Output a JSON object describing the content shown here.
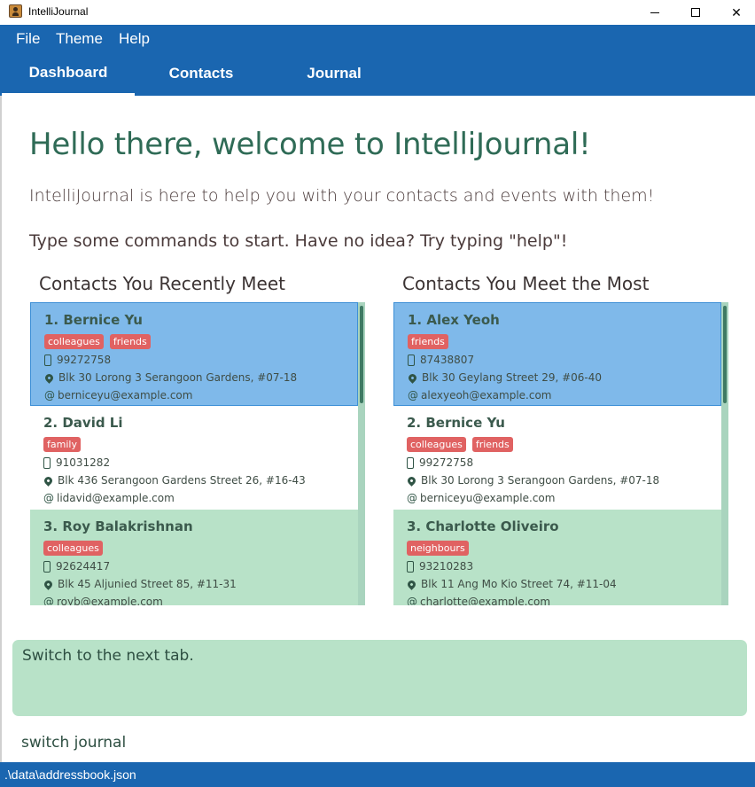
{
  "window": {
    "title": "IntelliJournal",
    "icon": "app-icon",
    "minimize_icon": "minimize-icon",
    "maximize_icon": "maximize-icon",
    "close_icon": "close-icon",
    "close_glyph": "✕"
  },
  "menu": {
    "items": [
      "File",
      "Theme",
      "Help"
    ]
  },
  "tabs": [
    {
      "label": "Dashboard",
      "active": true
    },
    {
      "label": "Contacts",
      "active": false
    },
    {
      "label": "Journal",
      "active": false
    }
  ],
  "dashboard": {
    "welcome": "Hello there, welcome to IntelliJournal!",
    "intro_line_1": "IntelliJournal is here to help you with your contacts and events with them!",
    "intro_line_2": "Type some commands to start. Have no idea? Try typing \"help\"!",
    "recent_title": "Contacts You Recently Meet",
    "most_title": "Contacts You Meet the Most",
    "recent": [
      {
        "name": "1.  Bernice Yu",
        "tags": [
          "colleagues",
          "friends"
        ],
        "phone": "99272758",
        "address": "Blk 30 Lorong 3 Serangoon Gardens, #07-18",
        "email": "berniceyu@example.com",
        "style": "sel"
      },
      {
        "name": "2.  David Li",
        "tags": [
          "family"
        ],
        "phone": "91031282",
        "address": "Blk 436 Serangoon Gardens Street 26, #16-43",
        "email": "lidavid@example.com",
        "style": "plain"
      },
      {
        "name": "3.  Roy Balakrishnan",
        "tags": [
          "colleagues"
        ],
        "phone": "92624417",
        "address": "Blk 45 Aljunied Street 85, #11-31",
        "email": "royb@example.com",
        "style": "alt"
      }
    ],
    "most": [
      {
        "name": "1.  Alex Yeoh",
        "tags": [
          "friends"
        ],
        "phone": "87438807",
        "address": "Blk 30 Geylang Street 29, #06-40",
        "email": "alexyeoh@example.com",
        "style": "sel"
      },
      {
        "name": "2.  Bernice Yu",
        "tags": [
          "colleagues",
          "friends"
        ],
        "phone": "99272758",
        "address": "Blk 30 Lorong 3 Serangoon Gardens, #07-18",
        "email": "berniceyu@example.com",
        "style": "plain"
      },
      {
        "name": "3.  Charlotte Oliveiro",
        "tags": [
          "neighbours"
        ],
        "phone": "93210283",
        "address": "Blk 11 Ang Mo Kio Street 74, #11-04",
        "email": "charlotte@example.com",
        "style": "alt"
      }
    ],
    "icons": {
      "phone": "phone-icon",
      "address": "location-pin-icon",
      "email": "at-sign-icon",
      "email_glyph": "@"
    }
  },
  "result": {
    "text": "Switch to the next tab."
  },
  "command": {
    "value": "switch journal"
  },
  "status": {
    "path": ".\\data\\addressbook.json"
  },
  "colors": {
    "accent": "#1a66b0",
    "selected_card": "#7fb9ea",
    "alt_card": "#b8e2c8",
    "tag": "#e06262",
    "heading": "#2f6b56"
  }
}
